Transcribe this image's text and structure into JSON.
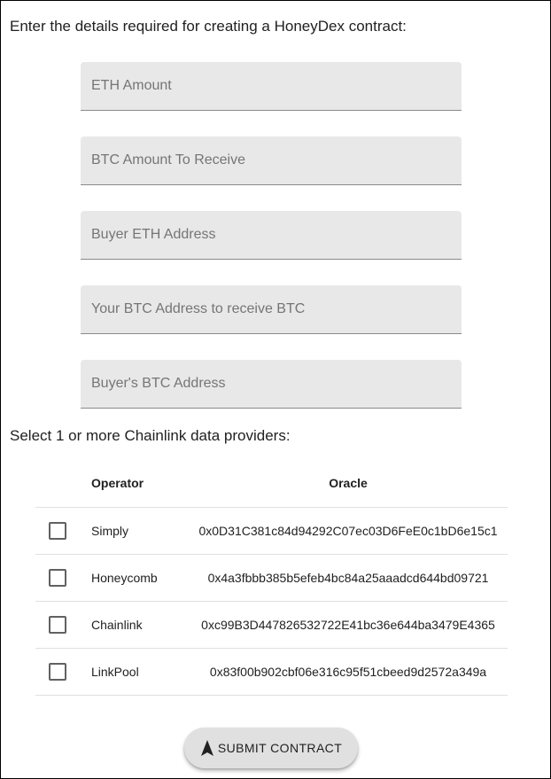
{
  "intro_text": "Enter the details required for creating a HoneyDex contract:",
  "fields": [
    {
      "placeholder": "ETH Amount",
      "value": ""
    },
    {
      "placeholder": "BTC Amount To Receive",
      "value": ""
    },
    {
      "placeholder": "Buyer ETH Address",
      "value": ""
    },
    {
      "placeholder": "Your BTC Address to receive BTC",
      "value": ""
    },
    {
      "placeholder": "Buyer's BTC Address",
      "value": ""
    }
  ],
  "select_label": "Select 1 or more Chainlink data providers:",
  "table": {
    "headers": {
      "operator": "Operator",
      "oracle": "Oracle"
    },
    "rows": [
      {
        "operator": "Simply",
        "oracle": "0x0D31C381c84d94292C07ec03D6FeE0c1bD6e15c1",
        "checked": false
      },
      {
        "operator": "Honeycomb",
        "oracle": "0x4a3fbbb385b5efeb4bc84a25aaadcd644bd09721",
        "checked": false
      },
      {
        "operator": "Chainlink",
        "oracle": "0xc99B3D447826532722E41bc36e644ba3479E4365",
        "checked": false
      },
      {
        "operator": "LinkPool",
        "oracle": "0x83f00b902cbf06e316c95f51cbeed9d2572a349a",
        "checked": false
      }
    ]
  },
  "submit": {
    "label": "SUBMIT CONTRACT",
    "icon": "send-arrow-icon"
  }
}
